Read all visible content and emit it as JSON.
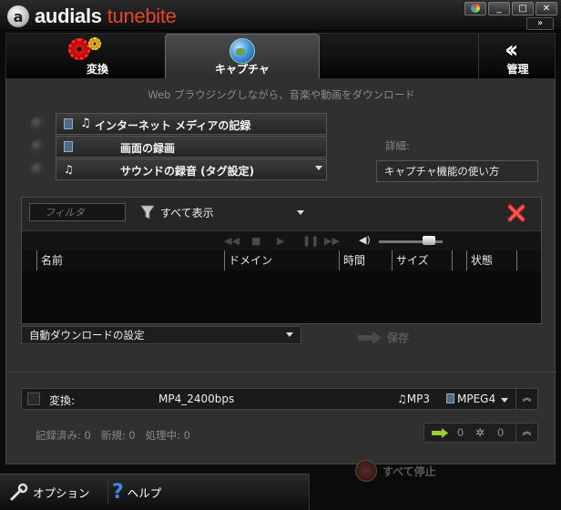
{
  "app": {
    "name_part1": "audials",
    "name_part2": "tunebite"
  },
  "window": {
    "more_label": "»",
    "minimize": "_",
    "maximize": "□",
    "close": "✕"
  },
  "tabs": [
    {
      "label": "変換"
    },
    {
      "label": "キャプチャ"
    },
    {
      "label": "管理"
    }
  ],
  "capture": {
    "subtitle": "Web ブラウジングしながら、音楽や動画をダウンロード",
    "modes": [
      {
        "label": "インターネット メディアの記録"
      },
      {
        "label": "画面の録画"
      },
      {
        "label": "サウンドの録音 (タグ設定)"
      }
    ],
    "detail_label": "詳細:",
    "help_link": "キャプチャ機能の使い方"
  },
  "downloads": {
    "filter_placeholder": "フィルタ",
    "show_all": "すべて表示",
    "volume_level": 0.85,
    "columns": [
      "名前",
      "ドメイン",
      "時間",
      "サイズ",
      "",
      "状態"
    ]
  },
  "auto_download": "自動ダウンロードの設定",
  "save_label": "保存",
  "convert": {
    "label": "変換:",
    "format": "MP4_2400bps",
    "audio": "MP3",
    "video": "MPEG4"
  },
  "stats": {
    "text": "記録済み: 0   新規: 0   処理中: 0",
    "count1": "0",
    "count2": "0"
  },
  "stop_all": "すべて停止",
  "footer": {
    "options": "オプション",
    "help": "ヘルプ"
  },
  "colors": {
    "accent_red": "#e8432e",
    "help_blue": "#3a8ae6"
  }
}
